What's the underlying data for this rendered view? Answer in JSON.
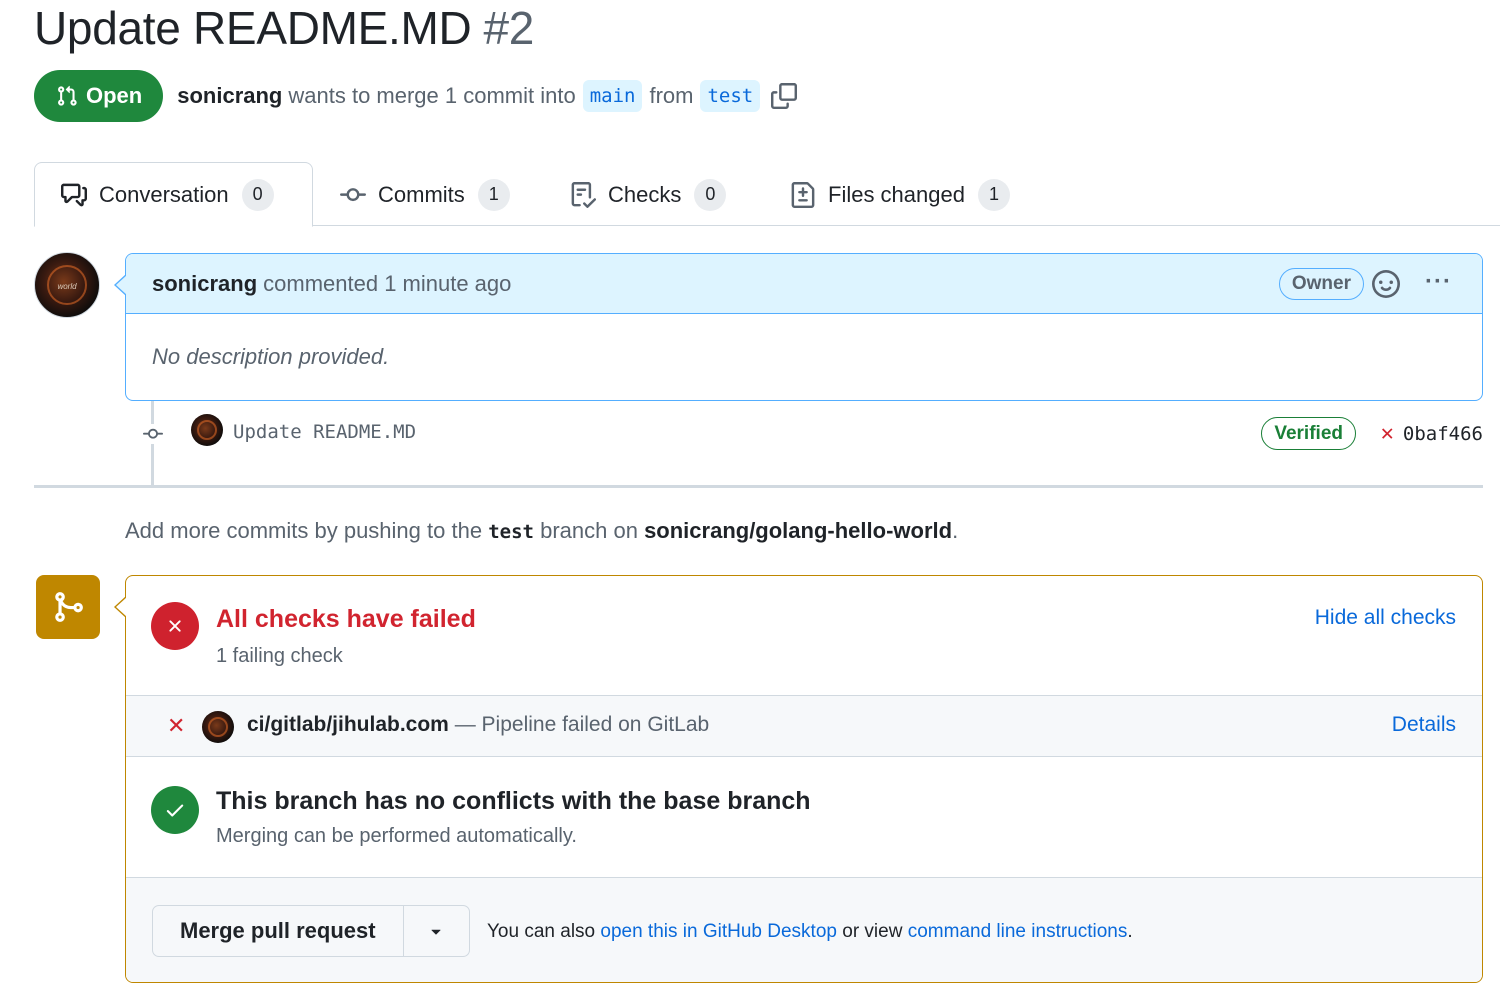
{
  "pr": {
    "title": "Update README.MD",
    "number": "#2",
    "state": "Open",
    "author": "sonicrang",
    "merge_text": "wants to merge 1 commit into",
    "base_branch": "main",
    "from_text": "from",
    "head_branch": "test"
  },
  "tabs": [
    {
      "label": "Conversation",
      "count": "0",
      "icon": "comment-discussion-icon"
    },
    {
      "label": "Commits",
      "count": "1",
      "icon": "git-commit-icon"
    },
    {
      "label": "Checks",
      "count": "0",
      "icon": "checklist-icon"
    },
    {
      "label": "Files changed",
      "count": "1",
      "icon": "file-diff-icon"
    }
  ],
  "comment": {
    "author": "sonicrang",
    "action": "commented 1 minute ago",
    "role": "Owner",
    "body": "No description provided."
  },
  "commit": {
    "message": "Update README.MD",
    "verified": "Verified",
    "sha": "0baf466",
    "status_symbol": "✕"
  },
  "push_hint": {
    "prefix": "Add more commits by pushing to the",
    "branch": "test",
    "middle": "branch on",
    "repo": "sonicrang/golang-hello-world",
    "suffix": "."
  },
  "merge": {
    "checks_title": "All checks have failed",
    "checks_sub": "1 failing check",
    "hide_link": "Hide all checks",
    "check_name": "ci/gitlab/jihulab.com",
    "check_desc": "— Pipeline failed on GitLab",
    "details_link": "Details",
    "conflict_title": "This branch has no conflicts with the base branch",
    "conflict_sub": "Merging can be performed automatically.",
    "button_label": "Merge pull request",
    "hint_prefix": "You can also",
    "hint_link1": "open this in GitHub Desktop",
    "hint_mid": "or view",
    "hint_link2": "command line instructions",
    "hint_suffix": "."
  },
  "colors": {
    "open_green": "#1f883d",
    "fail_red": "#cf222e",
    "link_blue": "#0969da",
    "merge_yellow": "#bf8700",
    "comment_blue": "#ddf4ff"
  }
}
